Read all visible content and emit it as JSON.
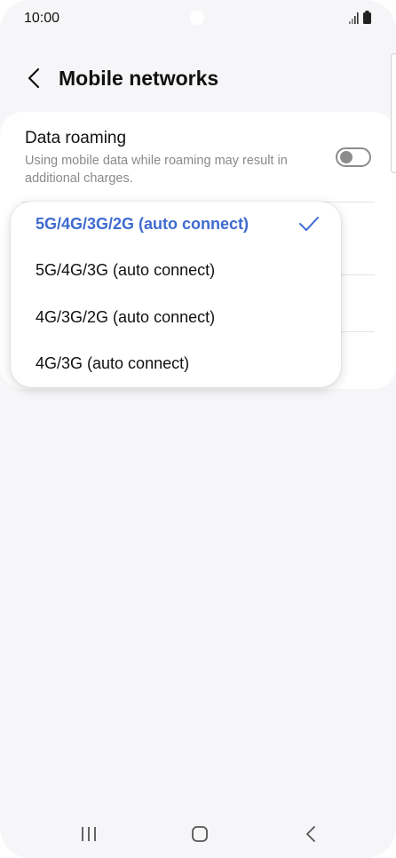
{
  "status_bar": {
    "time": "10:00"
  },
  "header": {
    "title": "Mobile networks"
  },
  "data_roaming": {
    "title": "Data roaming",
    "description": "Using mobile data while roaming may result in additional charges.",
    "enabled": false
  },
  "network_mode_dropdown": {
    "selected_index": 0,
    "accent_color": "#3f6bd0",
    "options": [
      {
        "label": "5G/4G/3G/2G (auto connect)"
      },
      {
        "label": "5G/4G/3G (auto connect)"
      },
      {
        "label": "4G/3G/2G (auto connect)"
      },
      {
        "label": "4G/3G (auto connect)"
      }
    ]
  },
  "nav_bar": {
    "icons": [
      "recent-apps-icon",
      "home-icon",
      "back-icon"
    ]
  }
}
